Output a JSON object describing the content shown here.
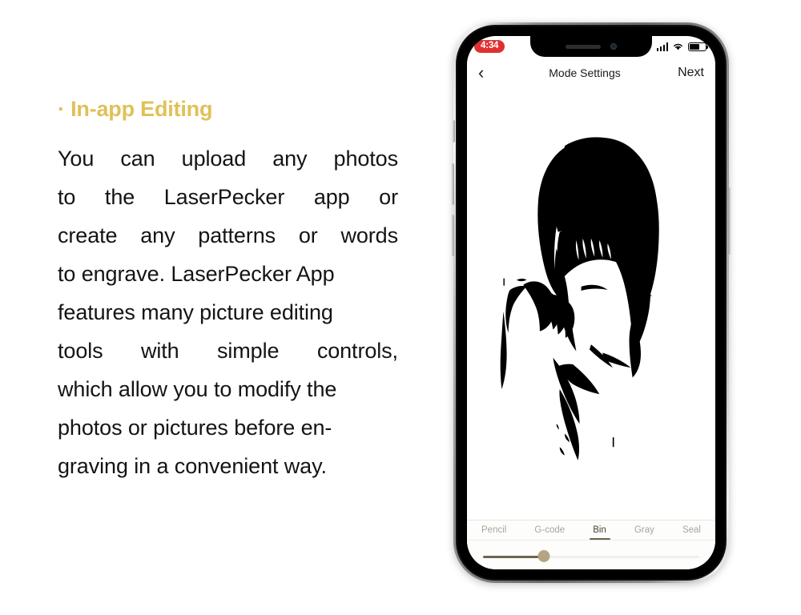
{
  "article": {
    "heading": "· In-app Editing",
    "paragraph_lines": [
      [
        "You",
        "can",
        "upload",
        "any",
        "photos"
      ],
      [
        "to",
        "the",
        "LaserPecker",
        "app",
        "or"
      ],
      [
        "create",
        "any",
        "patterns",
        "or",
        "words"
      ],
      [
        "to engrave. LaserPecker App"
      ],
      [
        "features many picture editing"
      ],
      [
        "tools",
        "with",
        "simple",
        "controls,"
      ],
      [
        "which allow you to modify the"
      ],
      [
        "photos or pictures before en-"
      ],
      [
        "graving in a convenient way."
      ]
    ],
    "heading_color": "#e0c158",
    "body_color": "#141414"
  },
  "phone": {
    "status_bar": {
      "time": "4:34",
      "recording_pill_color": "#e03131",
      "signal_icon": "signal-bars-icon",
      "wifi_icon": "wifi-icon",
      "battery_icon": "battery-icon",
      "battery_level_percent": 62
    },
    "nav_bar": {
      "back_label": "‹",
      "title": "Mode Settings",
      "next_label": "Next"
    },
    "canvas": {
      "artwork_description": "High-contrast black and white threshold portrait of a woman with a bob haircut and blunt bangs, eyes closed, one hand raised to her head"
    },
    "tool_panel": {
      "tabs": [
        {
          "label": "Pencil",
          "active": false
        },
        {
          "label": "G-code",
          "active": false
        },
        {
          "label": "Bin",
          "active": true
        },
        {
          "label": "Gray",
          "active": false
        },
        {
          "label": "Seal",
          "active": false
        }
      ],
      "slider": {
        "value_percent": 28,
        "fill_color": "#6d6450",
        "thumb_color": "#b5a484",
        "track_color": "#efefef"
      }
    }
  }
}
